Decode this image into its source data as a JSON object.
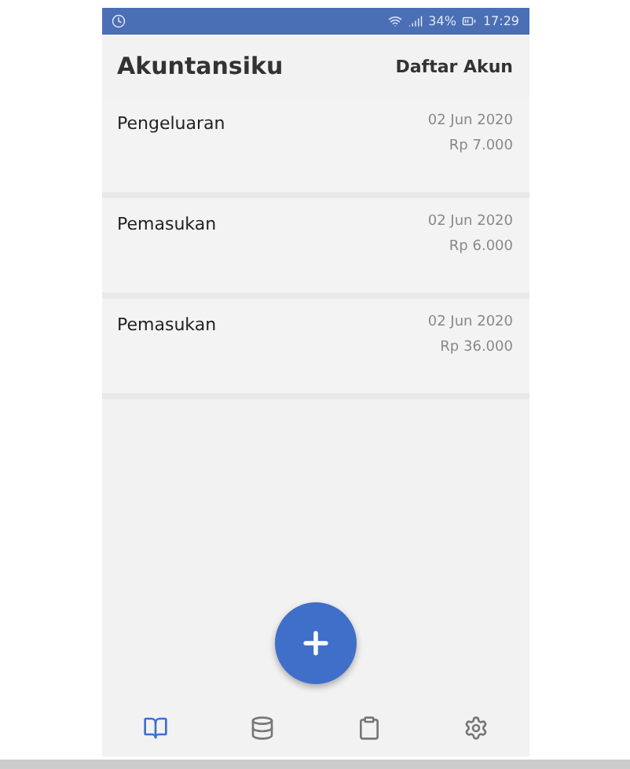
{
  "status_bar": {
    "battery": "34%",
    "time": "17:29"
  },
  "header": {
    "title": "Akuntansiku",
    "action": "Daftar Akun"
  },
  "transactions": [
    {
      "type": "Pengeluaran",
      "date": "02 Jun 2020",
      "amount": "Rp 7.000"
    },
    {
      "type": "Pemasukan",
      "date": "02 Jun 2020",
      "amount": "Rp 6.000"
    },
    {
      "type": "Pemasukan",
      "date": "02 Jun 2020",
      "amount": "Rp 36.000"
    }
  ],
  "nav": [
    {
      "kind": "book",
      "selected": true
    },
    {
      "kind": "database",
      "selected": false
    },
    {
      "kind": "clipboard",
      "selected": false
    },
    {
      "kind": "settings",
      "selected": false
    }
  ]
}
